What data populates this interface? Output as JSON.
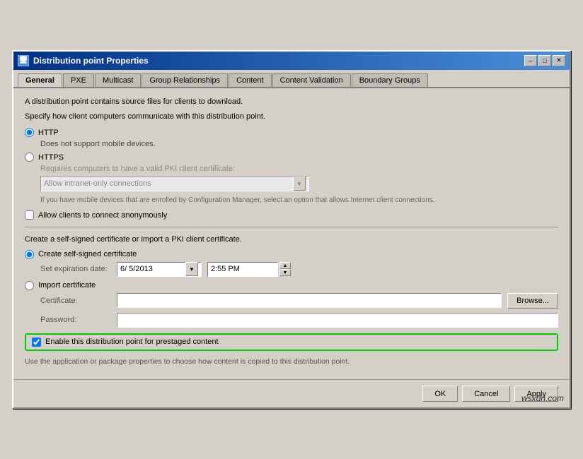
{
  "window": {
    "title": "Distribution point Properties",
    "title_icon": "🖥"
  },
  "title_controls": {
    "minimize": "–",
    "maximize": "□",
    "close": "✕"
  },
  "tabs": [
    {
      "label": "General",
      "active": true
    },
    {
      "label": "PXE",
      "active": false
    },
    {
      "label": "Multicast",
      "active": false
    },
    {
      "label": "Group Relationships",
      "active": false
    },
    {
      "label": "Content",
      "active": false
    },
    {
      "label": "Content Validation",
      "active": false
    },
    {
      "label": "Boundary Groups",
      "active": false
    }
  ],
  "content": {
    "intro_line1": "A distribution point contains source files for clients to download.",
    "intro_line2": "Specify how client computers communicate with this distribution point.",
    "http_label": "HTTP",
    "http_note": "Does not support mobile devices.",
    "https_label": "HTTPS",
    "https_note": "Requires computers to have a valid PKI client certificate:",
    "combo_value": "Allow intranet-only connections",
    "mobile_note": "If you have mobile devices that are enrolled by Configuration Manager, select an option that allows Internet client connections.",
    "anon_checkbox_label": "Allow clients to connect anonymously",
    "cert_section_label": "Create a self-signed certificate or import a PKI client certificate.",
    "create_cert_label": "Create self-signed certificate",
    "expiration_label": "Set expiration date:",
    "date_value": "6/ 5/2013",
    "time_value": "2:55 PM",
    "import_cert_label": "Import certificate",
    "certificate_label": "Certificate:",
    "password_label": "Password:",
    "browse_label": "Browse...",
    "prestaged_label": "Enable this distribution point for prestaged content",
    "prestaged_note": "Use the application or package properties to choose how content is copied to this distribution point."
  },
  "buttons": {
    "ok": "OK",
    "cancel": "Cancel",
    "apply": "Apply"
  },
  "watermark": "wsxdn.com"
}
